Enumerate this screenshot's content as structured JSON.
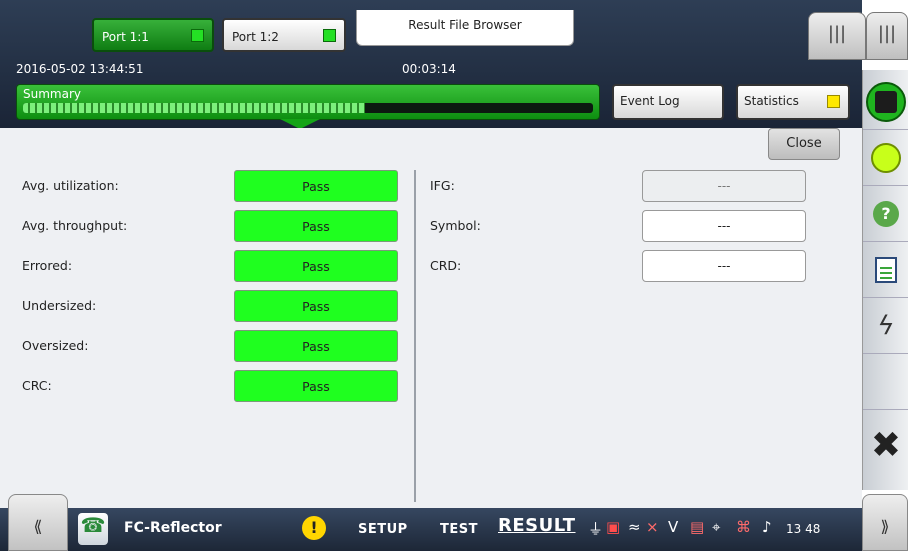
{
  "header": {
    "ports": [
      {
        "label": "Port 1:1",
        "led_color": "#24e024"
      },
      {
        "label": "Port 1:2",
        "led_color": "#24e024"
      }
    ],
    "result_file_browser": "Result File Browser",
    "date_time": "2016-05-02 13:44:51",
    "elapsed": "00:03:14",
    "summary_label": "Summary",
    "summary_progress": 0.6,
    "event_log": "Event Log",
    "statistics": "Statistics",
    "statistics_led_color": "#ffe800"
  },
  "panel": {
    "close": "Close",
    "left_rows": [
      {
        "label": "Avg. utilization:",
        "value": "Pass"
      },
      {
        "label": "Avg. throughput:",
        "value": "Pass"
      },
      {
        "label": "Errored:",
        "value": "Pass"
      },
      {
        "label": "Undersized:",
        "value": "Pass"
      },
      {
        "label": "Oversized:",
        "value": "Pass"
      },
      {
        "label": "CRC:",
        "value": "Pass"
      }
    ],
    "right_rows": [
      {
        "label": "IFG:",
        "value": "---"
      },
      {
        "label": "Symbol:",
        "value": "---"
      },
      {
        "label": "CRD:",
        "value": "---"
      }
    ]
  },
  "sidebar": {
    "help": "?",
    "icons": [
      "stop-icon",
      "status-circle-icon",
      "help-icon",
      "report-icon",
      "error-inject-icon",
      "close-x-icon"
    ]
  },
  "bottom": {
    "grip_left": "⟪",
    "grip_right": "⟫",
    "app_name": "FC-Reflector",
    "warning": "!",
    "nav": {
      "setup": "SETUP",
      "test": "TEST",
      "result": "RESULT"
    },
    "clock": "13 48"
  },
  "colors": {
    "pass": "#1fff1f",
    "accent_green": "#14a416",
    "header_bg": "#2e3e55"
  }
}
